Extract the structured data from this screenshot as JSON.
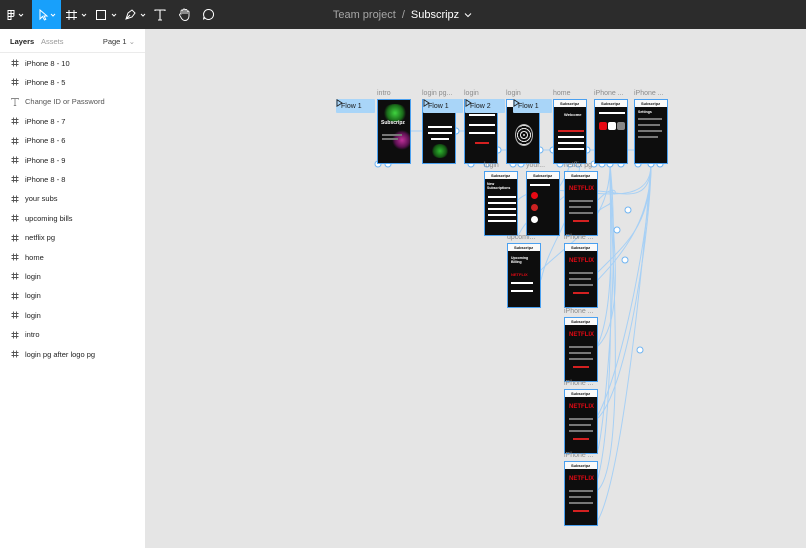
{
  "toolbar": {
    "team": "Team project",
    "separator": "/",
    "file_name": "Subscripz",
    "tools": [
      "figma-menu-icon",
      "move-tool-icon",
      "frame-tool-icon",
      "shape-tool-icon",
      "pen-tool-icon",
      "text-tool-icon",
      "hand-tool-icon",
      "comment-tool-icon"
    ],
    "accent": "#18a0fb"
  },
  "panel": {
    "tabs": {
      "layers": "Layers",
      "assets": "Assets",
      "page": "Page 1"
    },
    "layers": [
      {
        "name": "iPhone 8 - 10",
        "icon": "frame-icon"
      },
      {
        "name": "iPhone 8 - 5",
        "icon": "frame-icon"
      },
      {
        "name": "Change ID or Password",
        "icon": "text-icon"
      },
      {
        "name": "iPhone 8 - 7",
        "icon": "frame-icon"
      },
      {
        "name": "iPhone 8 - 6",
        "icon": "frame-icon"
      },
      {
        "name": "iPhone 8 - 9",
        "icon": "frame-icon"
      },
      {
        "name": "iPhone 8 - 8",
        "icon": "frame-icon"
      },
      {
        "name": "your subs",
        "icon": "frame-icon"
      },
      {
        "name": "upcoming bills",
        "icon": "frame-icon"
      },
      {
        "name": "netflix pg",
        "icon": "frame-icon"
      },
      {
        "name": "home",
        "icon": "frame-icon"
      },
      {
        "name": "login",
        "icon": "frame-icon"
      },
      {
        "name": "login",
        "icon": "frame-icon"
      },
      {
        "name": "login",
        "icon": "frame-icon"
      },
      {
        "name": "intro",
        "icon": "frame-icon"
      },
      {
        "name": "login pg after logo pg",
        "icon": "frame-icon"
      }
    ]
  },
  "canvas": {
    "frame_labels": [
      "intro",
      "login pg...",
      "login",
      "login",
      "home",
      "iPhone ...",
      "iPhone ...",
      "login",
      "your...",
      "netflix pg",
      "upcomi...",
      "iPhone ...",
      "iPhone ...",
      "iPhone ...",
      "iPhone ..."
    ],
    "flows": [
      "Flow 1",
      "Flow 1",
      "Flow 2",
      "Flow 1"
    ],
    "screen_texts": {
      "brand": "Subscripz",
      "netflix": "NETFLIX",
      "welcome": "Welcome",
      "upcoming": "Upcoming Billing",
      "new_subs": "New Subscriptions",
      "settings": "Settings"
    },
    "connector_color": "#a7d0f5",
    "frame_border": "#4aa0f0"
  }
}
